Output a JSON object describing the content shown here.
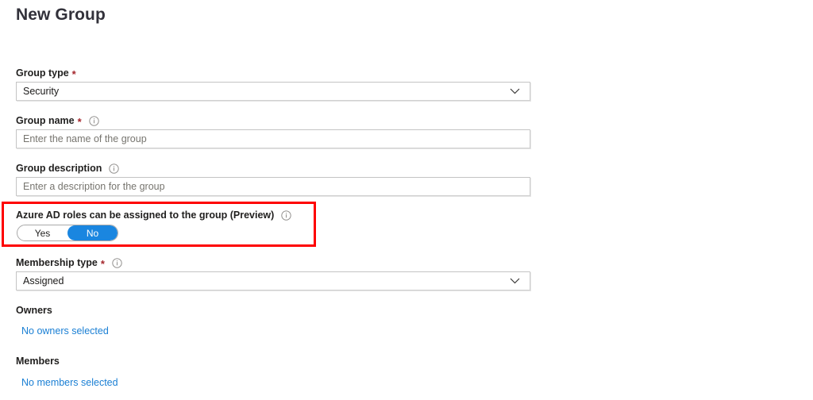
{
  "page": {
    "title": "New Group"
  },
  "form": {
    "group_type": {
      "label": "Group type",
      "required_marker": "*",
      "value": "Security",
      "chevron_icon": "chevron-down-icon"
    },
    "group_name": {
      "label": "Group name",
      "required_marker": "*",
      "value": "",
      "placeholder": "Enter the name of the group",
      "info_icon": "info-icon"
    },
    "group_description": {
      "label": "Group description",
      "value": "",
      "placeholder": "Enter a description for the group",
      "info_icon": "info-icon"
    },
    "azure_ad_roles": {
      "label": "Azure AD roles can be assigned to the group (Preview)",
      "info_icon": "info-icon",
      "options": [
        "Yes",
        "No"
      ],
      "selected": "No",
      "yes_label": "Yes",
      "no_label": "No"
    },
    "membership_type": {
      "label": "Membership type",
      "required_marker": "*",
      "value": "Assigned",
      "info_icon": "info-icon",
      "chevron_icon": "chevron-down-icon"
    },
    "owners": {
      "label": "Owners",
      "link_text": "No owners selected"
    },
    "members": {
      "label": "Members",
      "link_text": "No members selected"
    }
  },
  "colors": {
    "accent_blue": "#1a86e0",
    "link_blue": "#1a7fd4",
    "required_red": "#a4262c",
    "highlight_red": "#fe0000",
    "text_primary": "#201f1e",
    "placeholder_gray": "#77756f",
    "input_border": "#c4c4c4"
  }
}
